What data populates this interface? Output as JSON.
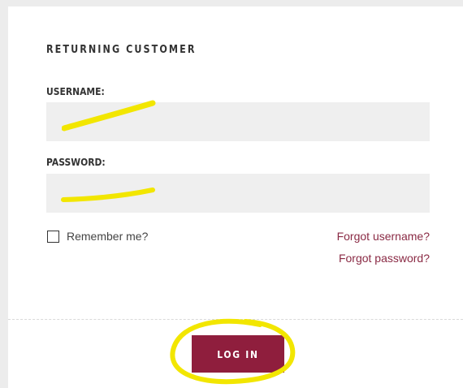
{
  "login_form": {
    "section_title": "RETURNING CUSTOMER",
    "username_label": "USERNAME:",
    "username_value": "",
    "password_label": "PASSWORD:",
    "password_value": "",
    "remember_label": "Remember me?",
    "remember_checked": false,
    "forgot_username": "Forgot username?",
    "forgot_password": "Forgot password?",
    "login_button": "LOG IN"
  },
  "colors": {
    "page_background": "#ececec",
    "panel_background": "#ffffff",
    "input_background": "#efefef",
    "accent": "#8f1e3d",
    "link": "#8a2a44",
    "highlight_annotation": "#f2e600"
  }
}
